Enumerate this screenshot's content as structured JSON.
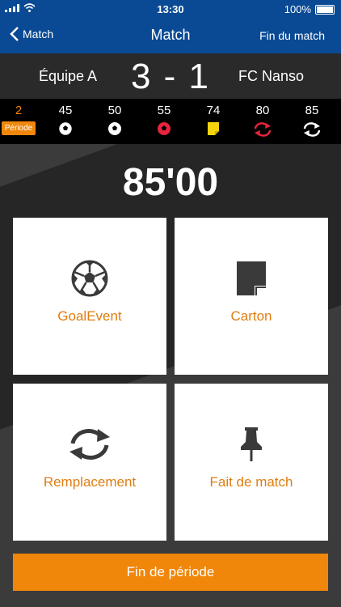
{
  "status": {
    "time": "13:30",
    "battery": "100%"
  },
  "nav": {
    "back_label": "Match",
    "title": "Match",
    "end_label": "Fin du match"
  },
  "score": {
    "home": "Équipe A",
    "away": "FC Nanso",
    "display": "3 - 1"
  },
  "timeline": {
    "period_minute": "2",
    "period_label": "Période",
    "events": [
      {
        "minute": "45",
        "icon": "soccer-ball-white"
      },
      {
        "minute": "50",
        "icon": "soccer-ball-white"
      },
      {
        "minute": "55",
        "icon": "soccer-ball-red"
      },
      {
        "minute": "74",
        "icon": "yellow-card"
      },
      {
        "minute": "80",
        "icon": "substitution-red"
      },
      {
        "minute": "85",
        "icon": "substitution-white"
      }
    ]
  },
  "timer": "85'00",
  "actions": {
    "goal_label": "GoalEvent",
    "card_label": "Carton",
    "sub_label": "Remplacement",
    "fact_label": "Fait de match"
  },
  "end_period_label": "Fin de période",
  "colors": {
    "nav": "#0a4a94",
    "accent": "#f0860a",
    "yellow_card": "#f5d40f",
    "red": "#e8243c"
  }
}
